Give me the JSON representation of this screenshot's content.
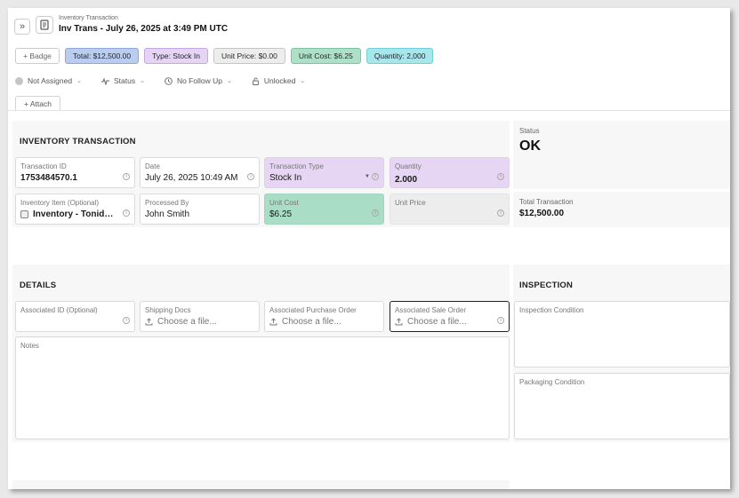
{
  "header": {
    "breadcrumb": "Inventory Transaction",
    "title": "Inv Trans - July 26, 2025 at 3:49 PM UTC",
    "expand_icon": "»"
  },
  "badges": {
    "add": "+ Badge",
    "total": "Total: $12,500.00",
    "type": "Type: Stock In",
    "unit_price": "Unit Price: $0.00",
    "unit_cost": "Unit Cost: $6.25",
    "quantity": "Quantity: 2,000"
  },
  "filters": {
    "assignee": "Not Assigned",
    "status": "Status",
    "follow_up": "No Follow Up",
    "lock": "Unlocked"
  },
  "attach_tab": "+ Attach",
  "inventory_section": {
    "title": "INVENTORY TRANSACTION",
    "fields": {
      "transaction_id": {
        "label": "Transaction ID",
        "value": "1753484570.1"
      },
      "date": {
        "label": "Date",
        "value": "July 26, 2025 10:49 AM"
      },
      "transaction_type": {
        "label": "Transaction Type",
        "value": "Stock In"
      },
      "quantity": {
        "label": "Quantity",
        "value": "2.000"
      },
      "inventory_item": {
        "label": "Inventory Item (Optional)",
        "value": "Inventory - Tonid…"
      },
      "processed_by": {
        "label": "Processed By",
        "value": "John Smith"
      },
      "unit_cost": {
        "label": "Unit Cost",
        "value": "$6.25"
      },
      "unit_price": {
        "label": "Unit Price",
        "value": ""
      }
    }
  },
  "status": {
    "label": "Status",
    "value": "OK"
  },
  "total_transaction": {
    "label": "Total Transaction",
    "value": "$12,500.00"
  },
  "details_section": {
    "title": "DETAILS",
    "associated_id": {
      "label": "Associated ID (Optional)"
    },
    "shipping_docs": {
      "label": "Shipping Docs",
      "placeholder": "Choose a file..."
    },
    "purchase_order": {
      "label": "Associated Purchase Order",
      "placeholder": "Choose a file..."
    },
    "sale_order": {
      "label": "Associated Sale Order",
      "placeholder": "Choose a file..."
    },
    "notes": {
      "label": "Notes"
    }
  },
  "inspection_section": {
    "title": "INSPECTION",
    "inspection_condition": {
      "label": "Inspection Condition"
    },
    "packaging_condition": {
      "label": "Packaging Condition"
    }
  },
  "colors": {
    "total": "#b9cdf0",
    "type": "#e6d4f4",
    "unit_cost": "#aedfc7",
    "quantity": "#a7e6ea"
  }
}
